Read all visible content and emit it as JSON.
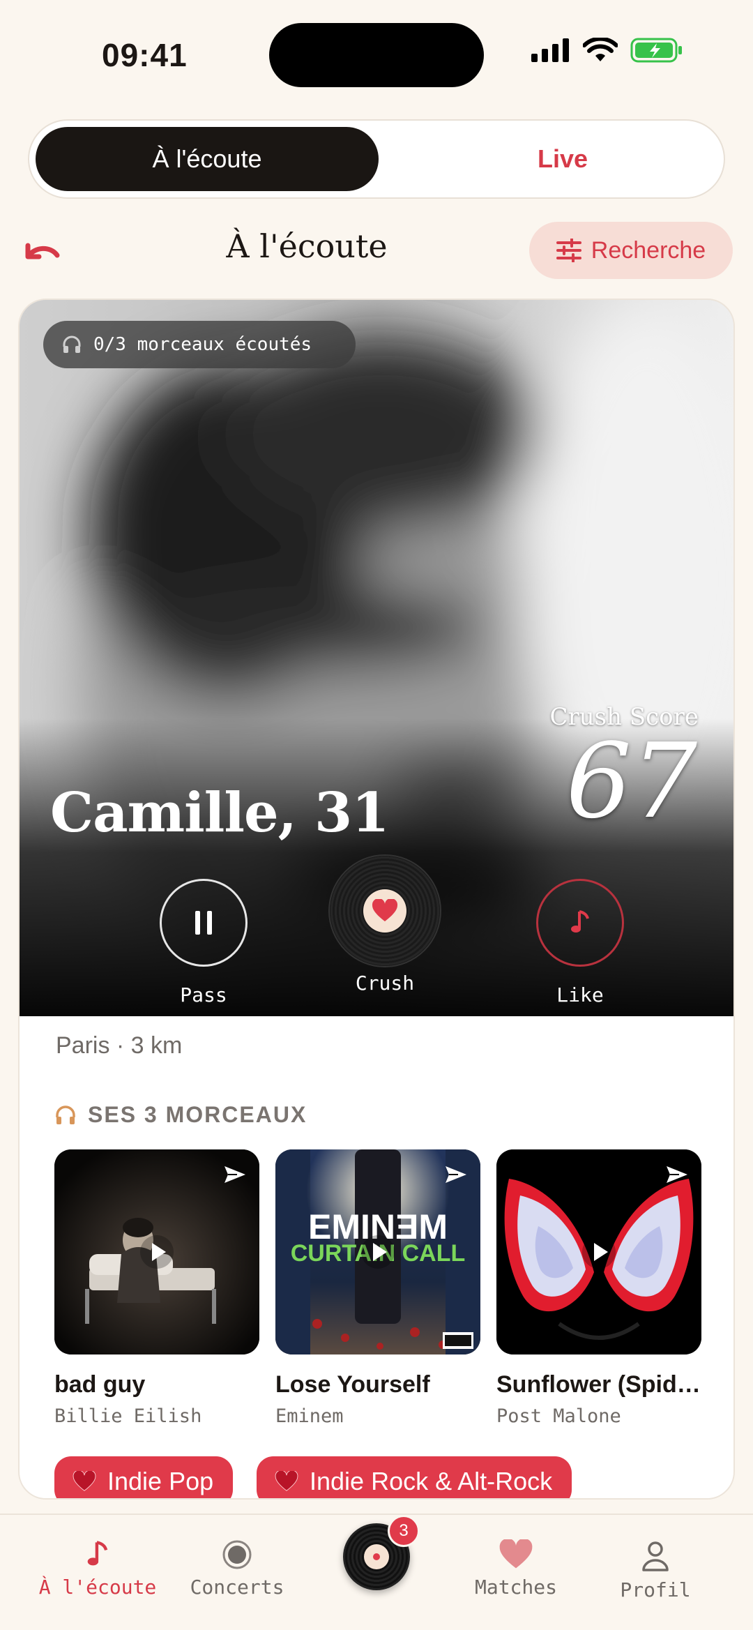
{
  "status": {
    "time": "09:41"
  },
  "segmented": {
    "active": "À l'écoute",
    "live": "Live"
  },
  "header": {
    "title": "À l'écoute",
    "search": "Recherche"
  },
  "profile": {
    "progress_text": "0/3 morceaux écoutés",
    "crush_score_label": "Crush Score",
    "crush_score": "67",
    "name_age": "Camille, 31",
    "location": "Paris · 3 km"
  },
  "actions": {
    "pass": "Pass",
    "crush": "Crush",
    "like": "Like"
  },
  "tracks_section": {
    "title": "SES 3 MORCEAUX",
    "tracks": [
      {
        "title": "bad guy",
        "artist": "Billie Eilish"
      },
      {
        "title": "Lose Yourself",
        "artist": "Eminem",
        "cover_text_1": "EMINƎM",
        "cover_text_2": "CURTAIN CALL"
      },
      {
        "title": "Sunflower (Spid…",
        "artist": "Post Malone"
      }
    ]
  },
  "genres": [
    "Indie Pop",
    "Indie Rock & Alt-Rock"
  ],
  "tabbar": {
    "tabs": [
      {
        "label": "À l'écoute",
        "icon": "music-note-icon"
      },
      {
        "label": "Concerts",
        "icon": "record-icon"
      },
      {
        "label": "Matches",
        "icon": "heart-icon"
      },
      {
        "label": "Profil",
        "icon": "person-icon"
      }
    ],
    "badge": "3"
  },
  "colors": {
    "accent": "#d63a48",
    "background": "#fbf6ef",
    "dark": "#1a1613"
  }
}
